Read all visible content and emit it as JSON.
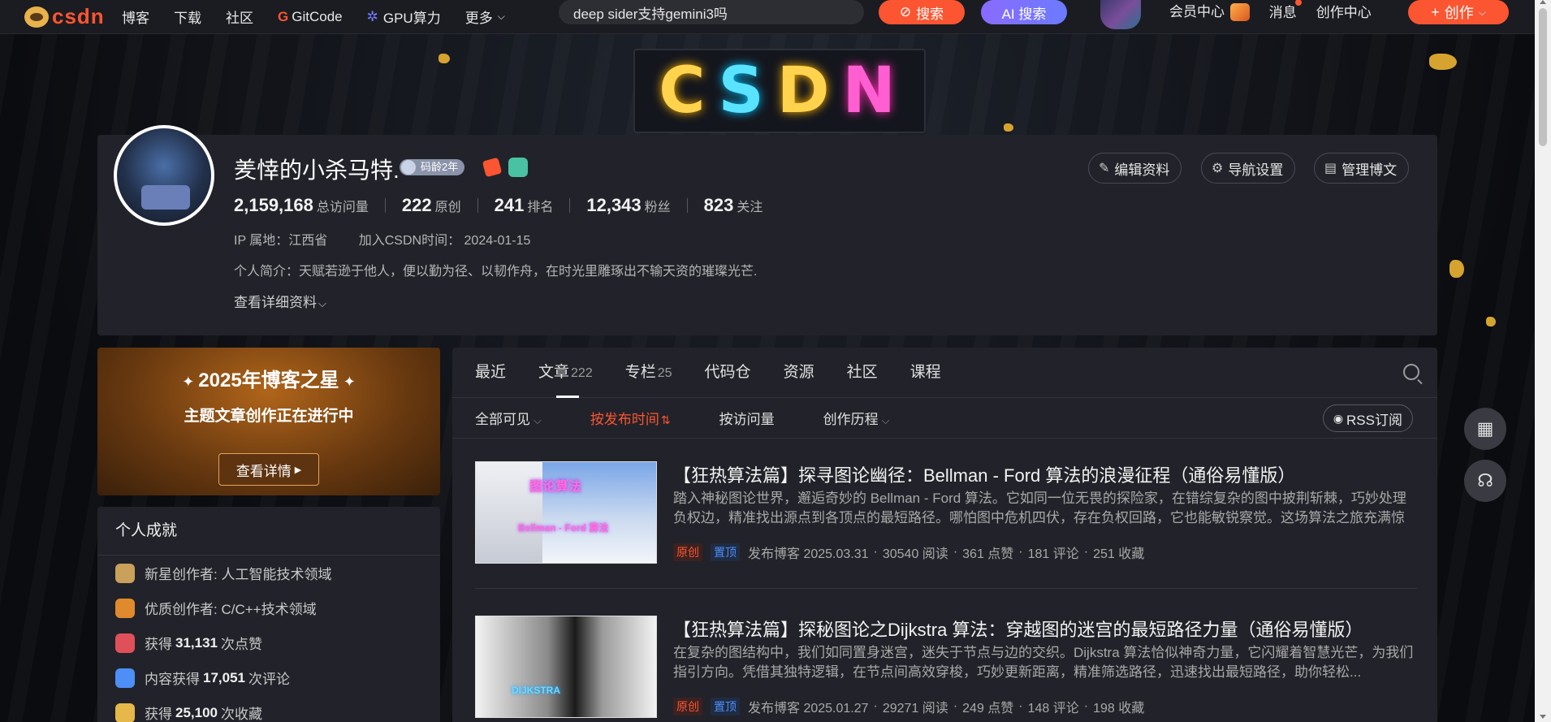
{
  "topbar": {
    "logo_text": "csdn",
    "nav": [
      "博客",
      "下载",
      "社区",
      "GitCode",
      "GPU算力",
      "更多"
    ],
    "search_value": "deep sider支持gemini3吗",
    "search_button": "搜索",
    "ai_search_button": "AI 搜索",
    "vip_center": "会员中心",
    "messages": "消息",
    "creator_center": "创作中心",
    "create_button": "创作"
  },
  "banner": {
    "neon_text": [
      "C",
      "S",
      "D",
      "N"
    ]
  },
  "profile": {
    "username": "羑悻的小杀马特.",
    "code_age": "码龄2年",
    "edit_button": "编辑资料",
    "nav_settings_button": "导航设置",
    "manage_button": "管理博文",
    "stats": [
      {
        "num": "2,159,168",
        "label": "总访问量"
      },
      {
        "num": "222",
        "label": "原创"
      },
      {
        "num": "241",
        "label": "排名"
      },
      {
        "num": "12,343",
        "label": "粉丝"
      },
      {
        "num": "823",
        "label": "关注"
      }
    ],
    "ip": "IP 属地：江西省",
    "joined": "加入CSDN时间：  2024-01-15",
    "intro": "个人简介：天赋若逊于他人，便以勤为径、以韧作舟，在时光里雕琢出不输天资的璀璨光芒.",
    "more_info": "查看详细资料"
  },
  "promo": {
    "title": "2025年博客之星",
    "subtitle": "主题文章创作正在进行中",
    "button": "查看详情"
  },
  "achievements": {
    "title": "个人成就",
    "items": [
      {
        "pre": "新星创作者: 人工智能技术领域",
        "num": "",
        "post": "",
        "color": "#c9a15a"
      },
      {
        "pre": "优质创作者: C/C++技术领域",
        "num": "",
        "post": "",
        "color": "#e08a2e"
      },
      {
        "pre": "获得",
        "num": "31,131",
        "post": "次点赞",
        "color": "#e0505a"
      },
      {
        "pre": "内容获得",
        "num": "17,051",
        "post": "次评论",
        "color": "#4d8ff7"
      },
      {
        "pre": "获得",
        "num": "25,100",
        "post": "次收藏",
        "color": "#e6b84a"
      }
    ]
  },
  "tabs": [
    {
      "label": "最近",
      "count": ""
    },
    {
      "label": "文章",
      "count": "222"
    },
    {
      "label": "专栏",
      "count": "25"
    },
    {
      "label": "代码仓",
      "count": ""
    },
    {
      "label": "资源",
      "count": ""
    },
    {
      "label": "社区",
      "count": ""
    },
    {
      "label": "课程",
      "count": ""
    }
  ],
  "filters": {
    "visibility": "全部可见",
    "by_time": "按发布时间",
    "by_visits": "按访问量",
    "history": "创作历程",
    "rss": "RSS订阅"
  },
  "articles": [
    {
      "title": "【狂热算法篇】探寻图论幽径：Bellman - Ford 算法的浪漫征程（通俗易懂版）",
      "desc": "踏入神秘图论世界，邂逅奇妙的 Bellman - Ford 算法。它如同一位无畏的探险家，在错综复杂的图中披荆斩棘，巧妙处理负权边，精准找出源点到各顶点的最短路径。哪怕图中危机四伏，存在负权回路，它也能敏锐察觉。这场算法之旅充满惊喜...",
      "thumb_text_top": "图论算法",
      "thumb_text_bottom": "Bellman - Ford 算法",
      "tag_orig": "原创",
      "tag_top": "置顶",
      "date": "发布博客 2025.03.31",
      "reads": "30540 阅读",
      "likes": "361 点赞",
      "comments": "181 评论",
      "favorites": "251 收藏"
    },
    {
      "title": "【狂热算法篇】探秘图论之Dijkstra 算法：穿越图的迷宫的最短路径力量（通俗易懂版）",
      "desc": "在复杂的图结构中，我们如同置身迷宫，迷失于节点与边的交织。Dijkstra 算法恰似神奇力量，它闪耀着智慧光芒，为我们指引方向。凭借其独特逻辑，在节点间高效穿梭，巧妙更新距离，精准筛选路径，迅速找出最短路径，助你轻松...",
      "thumb_text_top": "",
      "thumb_text_bottom": "DIJKSTRA",
      "tag_orig": "原创",
      "tag_top": "置顶",
      "date": "发布博客 2025.01.27",
      "reads": "29271 阅读",
      "likes": "249 点赞",
      "comments": "148 评论",
      "favorites": "198 收藏"
    }
  ],
  "colors": {
    "accent": "#fc5531",
    "panel": "#22232a",
    "ai": "#7b72ff",
    "pinned": "#4d8ff7"
  },
  "floating": {
    "qr_icon": "qrcode-icon",
    "service_icon": "headset-icon"
  }
}
